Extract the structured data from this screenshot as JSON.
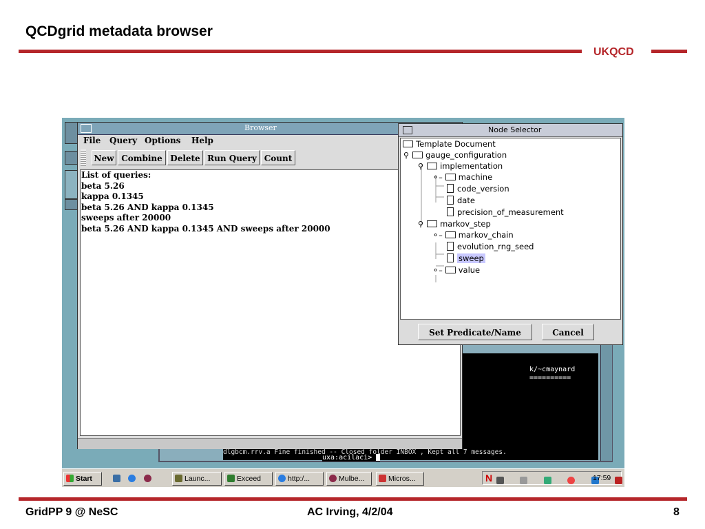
{
  "slide": {
    "title": "QCDgrid metadata browser",
    "brand": "UKQCD",
    "footer_left": "GridPP 9 @ NeSC",
    "footer_center": "AC Irving, 4/2/04",
    "page_number": "8"
  },
  "colors": {
    "accent_red": "#b5262a",
    "desktop": "#7aabb8",
    "window_title": "#7fa4b8",
    "selection": "#c8c8ff"
  },
  "browser": {
    "title": "Browser",
    "menu": [
      "File",
      "Query",
      "Options",
      "Help"
    ],
    "toolbar": {
      "new": "New",
      "combine": "Combine",
      "delete": "Delete",
      "run_query": "Run Query",
      "count": "Count"
    },
    "list_header": "List of queries:",
    "queries": [
      "beta 5.26",
      "kappa 0.1345",
      "beta 5.26 AND kappa 0.1345",
      "sweeps after 20000",
      "beta 5.26 AND kappa 0.1345 AND sweeps after 20000"
    ]
  },
  "node_selector": {
    "title": "Node Selector",
    "nodes": {
      "root": "Template Document",
      "gauge_configuration": "gauge_configuration",
      "implementation": "implementation",
      "machine": "machine",
      "code_version": "code_version",
      "date": "date",
      "precision_of_measurement": "precision_of_measurement",
      "markov_step": "markov_step",
      "markov_chain": "markov_chain",
      "evolution_rng_seed": "evolution_rng_seed",
      "sweep": "sweep",
      "value": "value"
    },
    "buttons": {
      "set_predicate": "Set Predicate/Name",
      "cancel": "Cancel"
    }
  },
  "terminal": {
    "user_line": "k/~cmaynard",
    "underline": "==========",
    "status_line": "dlgbcm.rrv.a Fine finished -- Closed folder  INBOX , Kept all 7 messages.",
    "prompt": "uxa:acilaci> "
  },
  "taskbar": {
    "start": "Start",
    "items": [
      "Launc...",
      "Exceed",
      "http:/...",
      "Mulbe...",
      "Micros..."
    ],
    "clock": "17:59"
  }
}
